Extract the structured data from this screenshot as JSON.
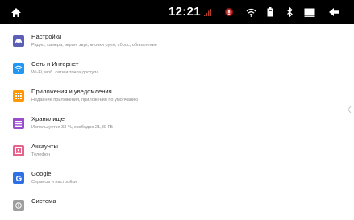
{
  "status_bar": {
    "time": "12:21",
    "icons": [
      "home-icon",
      "signal-icon",
      "alert-icon",
      "wifi-icon",
      "battery-icon",
      "bluetooth-icon",
      "window-icon",
      "back-icon"
    ]
  },
  "settings": {
    "items": [
      {
        "title": "Настройки",
        "subtitle": "Радио, камера, экран, звук, кнопки руля, сброс, обновление",
        "icon": "car-icon",
        "color": "#5c5fb8"
      },
      {
        "title": "Сеть и Интернет",
        "subtitle": "Wi-Fi, моб. сети и точка доступа",
        "icon": "wifi-icon",
        "color": "#2196f3"
      },
      {
        "title": "Приложения и уведомления",
        "subtitle": "Недавние приложения, приложения по умолчанию",
        "icon": "apps-icon",
        "color": "#ff9800"
      },
      {
        "title": "Хранилище",
        "subtitle": "Используется 33 %, свободно 21,39 ГБ",
        "icon": "storage-icon",
        "color": "#9c4dcc"
      },
      {
        "title": "Аккаунты",
        "subtitle": "Телефон",
        "icon": "account-icon",
        "color": "#e5628a"
      },
      {
        "title": "Google",
        "subtitle": "Сервисы и настройки",
        "icon": "google-icon",
        "color": "#2f6fe6"
      },
      {
        "title": "Система",
        "subtitle": "",
        "icon": "system-icon",
        "color": "#9e9e9e"
      }
    ]
  }
}
